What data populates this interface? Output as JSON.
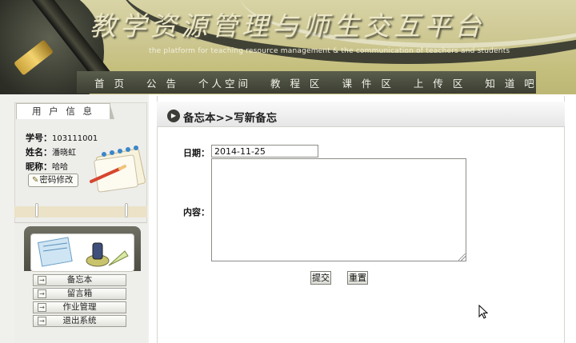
{
  "banner": {
    "title": "教学资源管理与师生交互平台",
    "subtitle": "the platform for teaching resource management & the communication of teachers and students"
  },
  "nav": [
    "首 页",
    "公 告",
    "个人空间",
    "教 程 区",
    "课 件 区",
    "上 传 区",
    "知 道 吧"
  ],
  "user_panel": {
    "tab_label": "用 户 信 息",
    "student_id_label": "学号：",
    "student_id": "103111001",
    "name_label": "姓名：",
    "name": "潘晓虹",
    "nickname_label": "昵称：",
    "nickname": "哈哈",
    "password_button": "密码修改"
  },
  "menu": [
    "备忘本",
    "留言箱",
    "作业管理",
    "退出系统"
  ],
  "main": {
    "heading": "备忘本>>写新备忘",
    "date_label": "日期：",
    "date_value": "2014-11-25",
    "content_label": "内容：",
    "submit_label": "提交",
    "reset_label": "重置"
  },
  "icons": {
    "heading": "play-circle-icon",
    "menu_arrow": "arrow-right-icon",
    "password": "pencil-icon"
  }
}
